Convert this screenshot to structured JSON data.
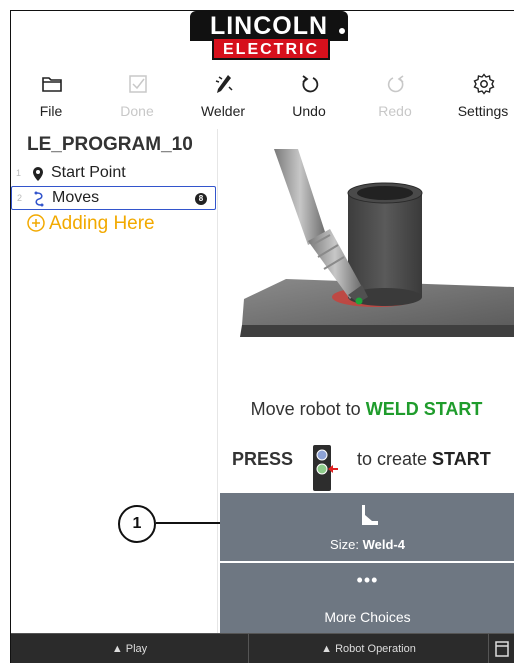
{
  "logo": {
    "line1": "LINCOLN",
    "line2": "ELECTRIC"
  },
  "toolbar": {
    "items": [
      {
        "label": "File",
        "icon": "folder-icon",
        "enabled": true
      },
      {
        "label": "Done",
        "icon": "checkbox-icon",
        "enabled": false
      },
      {
        "label": "Welder",
        "icon": "welder-torch-icon",
        "enabled": true
      },
      {
        "label": "Undo",
        "icon": "undo-icon",
        "enabled": true
      },
      {
        "label": "Redo",
        "icon": "redo-icon",
        "enabled": false
      },
      {
        "label": "Settings",
        "icon": "gear-icon",
        "enabled": true
      }
    ]
  },
  "program": {
    "title": "LE_PROGRAM_10",
    "steps": [
      {
        "num": "1",
        "label": "Start Point",
        "icon": "map-pin-icon"
      },
      {
        "num": "2",
        "label": "Moves",
        "icon": "path-icon",
        "badge": "8"
      }
    ],
    "adding_label": "Adding Here"
  },
  "instructions": {
    "line1_prefix": "Move robot to ",
    "line1_emph": "WELD START",
    "press": "PRESS",
    "line2_middle": "to create ",
    "line2_emph": "START"
  },
  "choices": {
    "size_prefix": "Size: ",
    "size_value": "Weld-4",
    "more_dots": "•••",
    "more_label": "More Choices"
  },
  "bottom_bar": {
    "play": "▲ Play",
    "robot_operation": "▲ Robot Operation"
  },
  "callout": {
    "number": "1"
  },
  "colors": {
    "accent_green": "#1f9c2c",
    "adding_orange": "#f2a900",
    "selection_blue": "#3355cc",
    "choice_bg": "#6e7782",
    "logo_red": "#d6101c"
  }
}
